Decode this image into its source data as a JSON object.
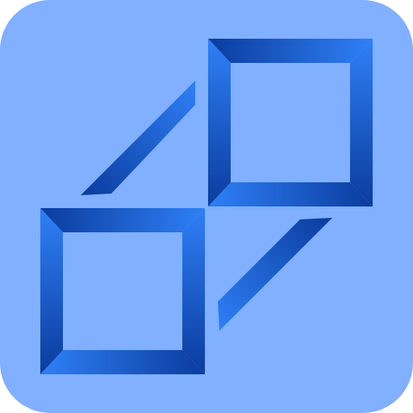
{
  "app_icon": {
    "icon_name": "linked-squares-icon",
    "colors": {
      "tile_background": "#80b0ff",
      "frame_light": "#2f80f7",
      "frame_mid": "#1d5fd0",
      "frame_dark": "#0b3c9e",
      "bevel_highlight": "#5ea0ff"
    }
  }
}
